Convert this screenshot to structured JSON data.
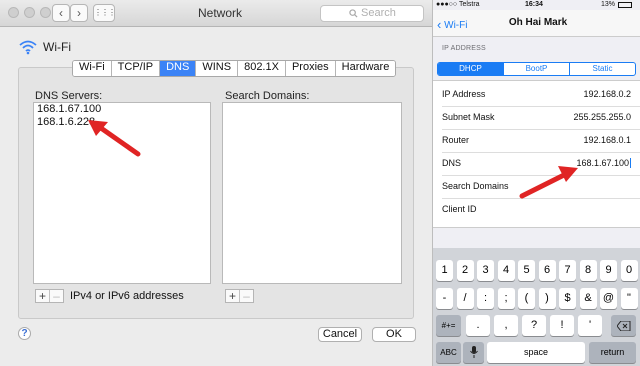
{
  "mac": {
    "window_title": "Network",
    "search_placeholder": "Search",
    "back_label": "‹",
    "forward_label": "›",
    "grid_label": "⋮⋮⋮",
    "interface_name": "Wi-Fi",
    "tabs": [
      "Wi-Fi",
      "TCP/IP",
      "DNS",
      "WINS",
      "802.1X",
      "Proxies",
      "Hardware"
    ],
    "active_tab": "DNS",
    "dns_servers_label": "DNS Servers:",
    "dns_servers": [
      "168.1.67.100",
      "168.1.6.228"
    ],
    "search_domains_label": "Search Domains:",
    "search_domains": [],
    "plus_label": "+",
    "minus_label": "–",
    "address_hint": "IPv4 or IPv6 addresses",
    "help_label": "?",
    "cancel_label": "Cancel",
    "ok_label": "OK"
  },
  "ios": {
    "status": {
      "carrier": "●●●○○ Telstra",
      "time": "16:34",
      "battery": "13%"
    },
    "nav": {
      "back_label": "Wi-Fi",
      "title": "Oh Hai Mark"
    },
    "group_header": "IP ADDRESS",
    "segments": [
      "DHCP",
      "BootP",
      "Static"
    ],
    "active_segment": "DHCP",
    "rows": [
      {
        "label": "IP Address",
        "value": "192.168.0.2"
      },
      {
        "label": "Subnet Mask",
        "value": "255.255.255.0"
      },
      {
        "label": "Router",
        "value": "192.168.0.1"
      },
      {
        "label": "DNS",
        "value": "168.1.67.100"
      },
      {
        "label": "Search Domains",
        "value": ""
      },
      {
        "label": "Client ID",
        "value": ""
      }
    ],
    "keyboard": {
      "row1": [
        "1",
        "2",
        "3",
        "4",
        "5",
        "6",
        "7",
        "8",
        "9",
        "0"
      ],
      "row2": [
        "-",
        "/",
        ":",
        ";",
        "(",
        ")",
        "$",
        "&",
        "@",
        "\""
      ],
      "row3": [
        ".",
        ",",
        "?",
        "!",
        "'"
      ],
      "symbols_label": "#+=",
      "abc_label": "ABC",
      "space_label": "space",
      "return_label": "return"
    }
  },
  "colors": {
    "mac_accent": "#3b83f6",
    "ios_tint": "#1a7cf4",
    "arrow": "#e02424"
  }
}
